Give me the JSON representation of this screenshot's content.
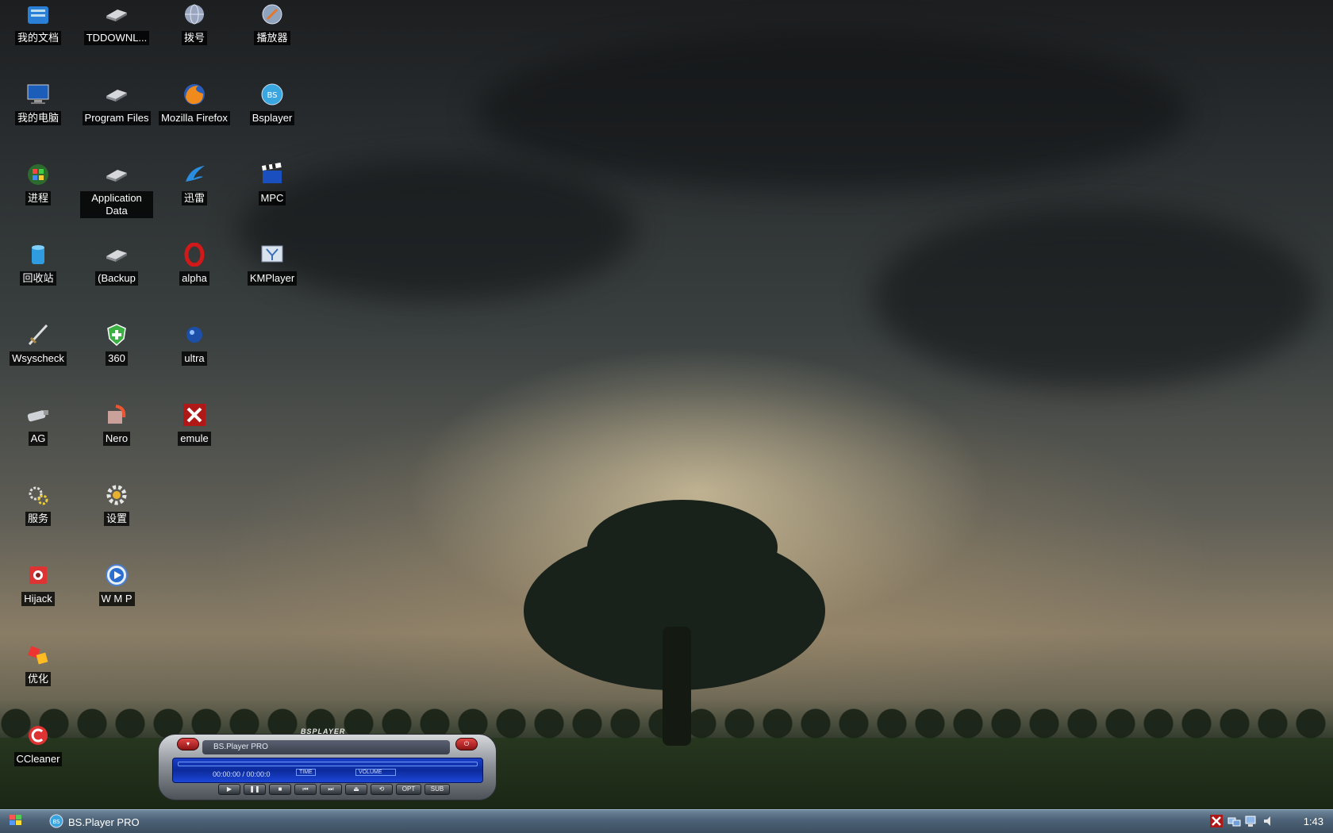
{
  "desktop": {
    "icons": [
      {
        "label": "我的文档",
        "icon": "documents-folder-icon"
      },
      {
        "label": "TDDOWNL...",
        "icon": "drive-icon"
      },
      {
        "label": "拨号",
        "icon": "dialup-globe-icon"
      },
      {
        "label": "播放器",
        "icon": "media-player-icon"
      },
      {
        "label": "我的电脑",
        "icon": "computer-icon"
      },
      {
        "label": "Program Files",
        "icon": "drive-icon"
      },
      {
        "label": "Mozilla Firefox",
        "icon": "firefox-icon"
      },
      {
        "label": "Bsplayer",
        "icon": "bsplayer-icon"
      },
      {
        "label": "进程",
        "icon": "windows-logo-icon"
      },
      {
        "label": "Application Data",
        "icon": "drive-icon"
      },
      {
        "label": "迅雷",
        "icon": "thunder-bird-icon"
      },
      {
        "label": "MPC",
        "icon": "clapperboard-icon"
      },
      {
        "label": "回收站",
        "icon": "recycle-bin-icon"
      },
      {
        "label": "(Backup",
        "icon": "drive-icon"
      },
      {
        "label": "alpha",
        "icon": "opera-icon"
      },
      {
        "label": "KMPlayer",
        "icon": "kmplayer-icon"
      },
      {
        "label": "Wsyscheck",
        "icon": "sword-icon"
      },
      {
        "label": "360",
        "icon": "shield-icon"
      },
      {
        "label": "ultra",
        "icon": "globe-icon"
      },
      {
        "label": "AG",
        "icon": "usb-key-icon"
      },
      {
        "label": "Nero",
        "icon": "nero-icon"
      },
      {
        "label": "emule",
        "icon": "emule-icon"
      },
      {
        "label": "服务",
        "icon": "gears-icon"
      },
      {
        "label": "设置",
        "icon": "settings-gear-icon"
      },
      {
        "label": "Hijack",
        "icon": "hijack-icon"
      },
      {
        "label": "W M P",
        "icon": "wmp-icon"
      },
      {
        "label": "优化",
        "icon": "optimize-cubes-icon"
      },
      {
        "label": "CCleaner",
        "icon": "ccleaner-icon"
      }
    ]
  },
  "player": {
    "brand": "BSPLAYER",
    "title": "BS.Player PRO",
    "time": "00:00:00 / 00:00:0",
    "time_label": "TIME",
    "volume_label": "VOLUME",
    "buttons": [
      "▶",
      "❚❚",
      "■",
      "⏮",
      "⏭",
      "⏏",
      "⟲",
      "OPT",
      "SUB"
    ]
  },
  "taskbar": {
    "task_label": "BS.Player PRO",
    "clock": "1:43",
    "tray_icons": [
      "emule-tray-icon",
      "network-tray-icon",
      "network-tray-icon",
      "volume-tray-icon"
    ]
  },
  "colors": {
    "taskbar": "#4e6377",
    "player_screen": "#1a3fc8",
    "label_bg": "#000000"
  }
}
